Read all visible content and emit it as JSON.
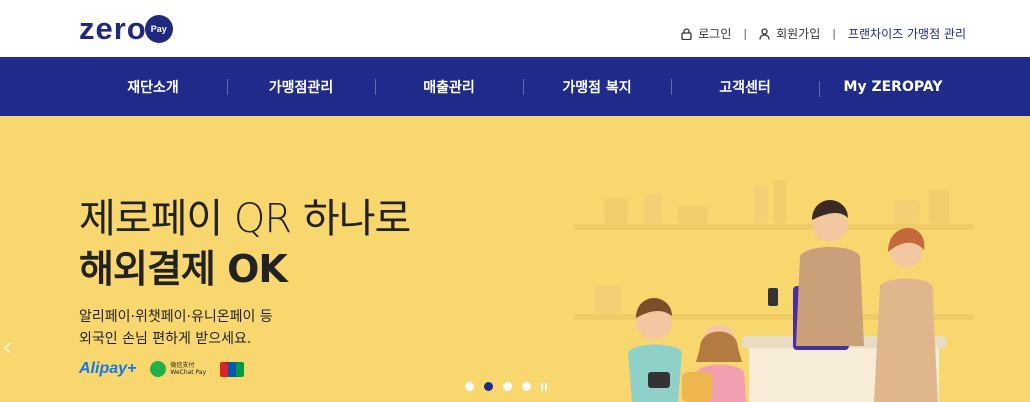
{
  "brand": {
    "logo_text": "zero",
    "logo_badge": "Pay"
  },
  "utility": {
    "login": "로그인",
    "signup": "회원가입",
    "franchise": "프랜차이즈 가맹점 관리"
  },
  "nav": {
    "tabs": [
      {
        "label": "재단소개"
      },
      {
        "label": "가맹점관리"
      },
      {
        "label": "매출관리"
      },
      {
        "label": "가맹점 복지"
      },
      {
        "label": "고객센터"
      },
      {
        "label": "My ZEROPAY"
      }
    ]
  },
  "hero": {
    "headline_light": "제로페이 QR 하나로",
    "headline_bold": "해외결제 OK",
    "sub_line1": "알리페이·위챗페이·유니온페이 등",
    "sub_line2": "외국인 손님 편하게 받으세요.",
    "alipay": "Alipay+",
    "wechat_line1": "微信支付",
    "wechat_line2": "WeChat Pay",
    "prev_arrow": "‹"
  },
  "carousel": {
    "count": 4,
    "active_index": 1
  },
  "colors": {
    "brand_navy": "#1f2a8a",
    "hero_yellow": "#f8d86e"
  },
  "icons": {
    "login": "lock-icon",
    "signup": "person-icon"
  }
}
